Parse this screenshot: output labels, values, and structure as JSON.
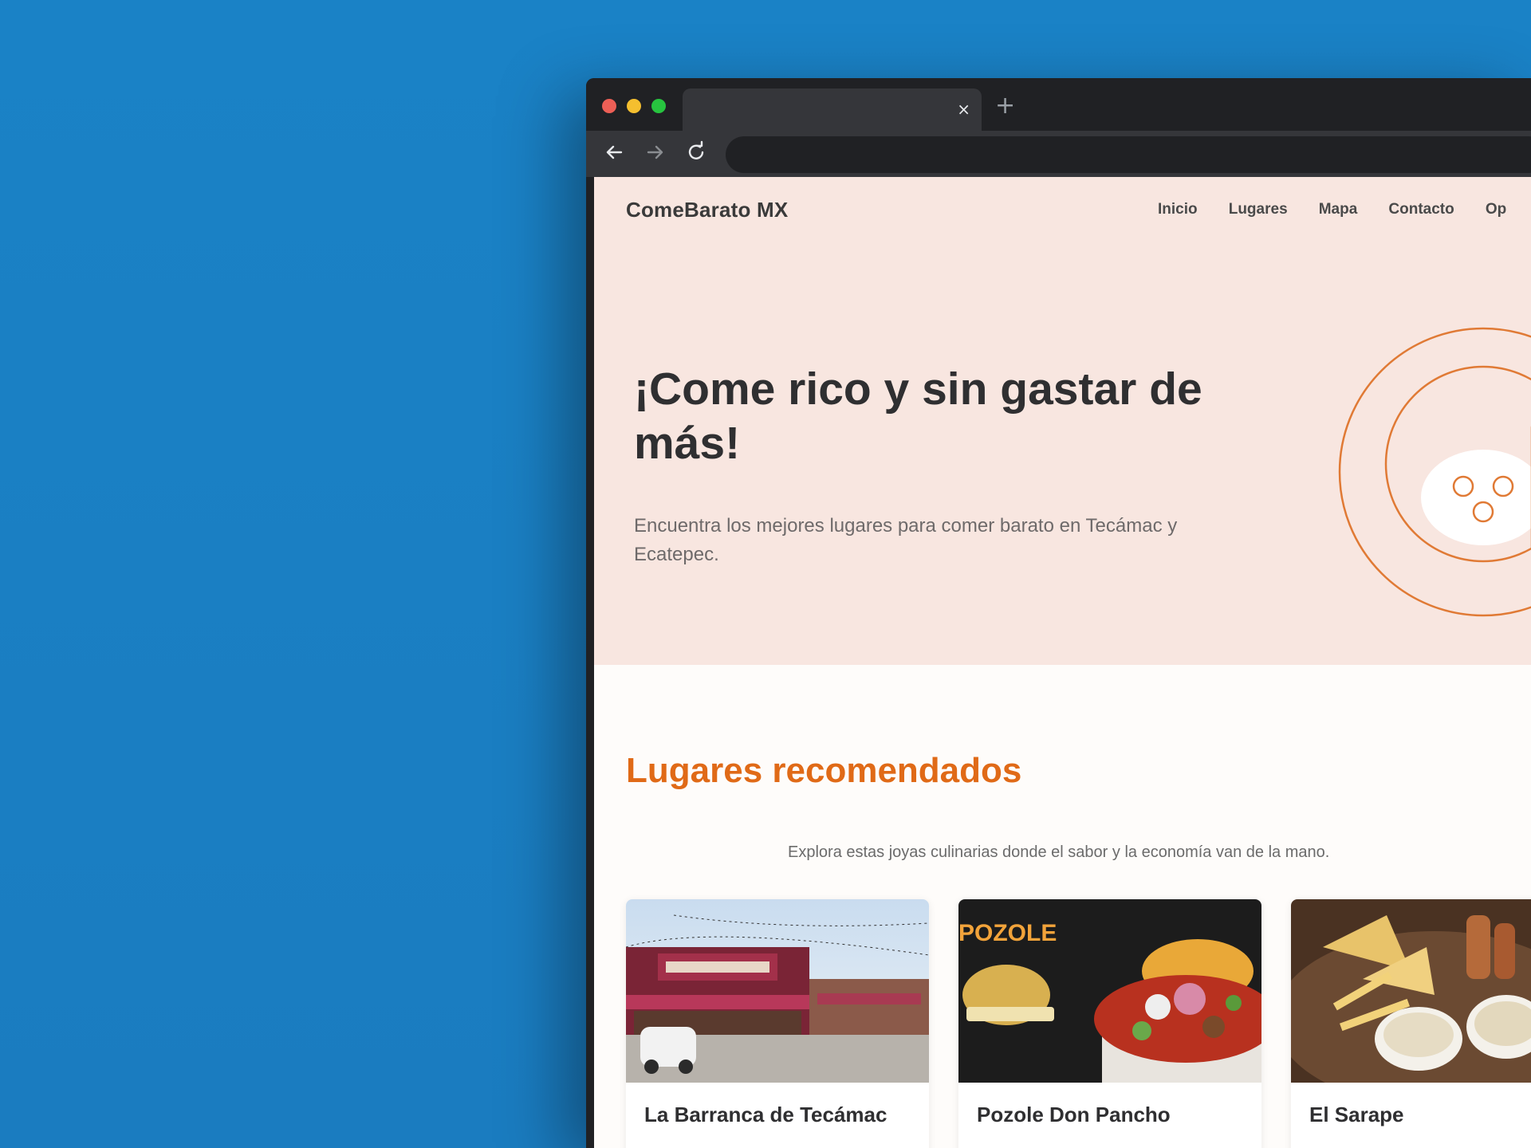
{
  "browser": {
    "tab_close_glyph": "×",
    "new_tab_glyph": "+"
  },
  "site": {
    "brand": "ComeBarato MX",
    "nav": [
      "Inicio",
      "Lugares",
      "Mapa",
      "Contacto",
      "Op"
    ]
  },
  "hero": {
    "title": "¡Come rico y sin gastar de más!",
    "subtitle": "Encuentra los mejores lugares para comer barato en Tecámac y Ecatepec."
  },
  "recommended": {
    "title": "Lugares recomendados",
    "subtitle": "Explora estas joyas culinarias donde el sabor y la economía van de la mano.",
    "cards": [
      {
        "title": "La Barranca de Tecámac",
        "image": "restaurant-facade-photo"
      },
      {
        "title": "Pozole Don Pancho",
        "image": "pozole-bowl-photo",
        "image_text": "POZOLE"
      },
      {
        "title": "El Sarape",
        "image": "food-platter-photo"
      }
    ]
  },
  "colors": {
    "desktop": "#1a80c4",
    "hero_bg": "#f8e6e0",
    "accent": "#e06a17",
    "text_dark": "#2f2f31"
  }
}
